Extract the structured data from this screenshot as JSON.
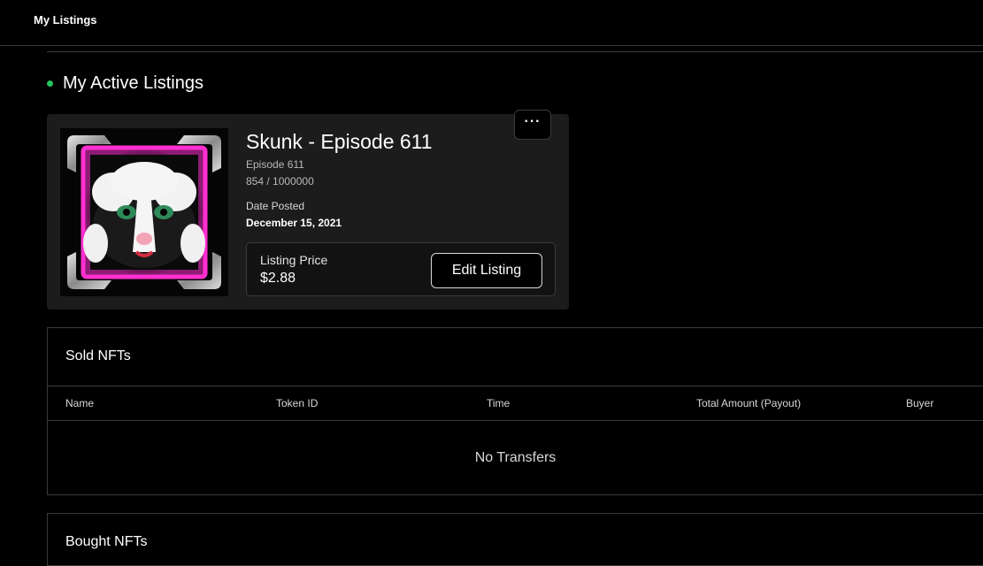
{
  "header": {
    "title": "My Listings"
  },
  "active_listings": {
    "heading": "My Active Listings",
    "accent_color": "#22c55e",
    "cards": [
      {
        "name": "Skunk - Episode 611",
        "episode": "Episode 611",
        "supply": "854 / 1000000",
        "date_label": "Date Posted",
        "date_value": "December 15, 2021",
        "price_label": "Listing Price",
        "price_value": "$2.88",
        "edit_label": "Edit Listing",
        "more_label": "···"
      }
    ]
  },
  "sold_nfts": {
    "title": "Sold NFTs",
    "columns": [
      "Name",
      "Token ID",
      "Time",
      "Total Amount (Payout)",
      "Buyer"
    ],
    "empty_message": "No Transfers"
  },
  "bought_nfts": {
    "title": "Bought NFTs"
  }
}
